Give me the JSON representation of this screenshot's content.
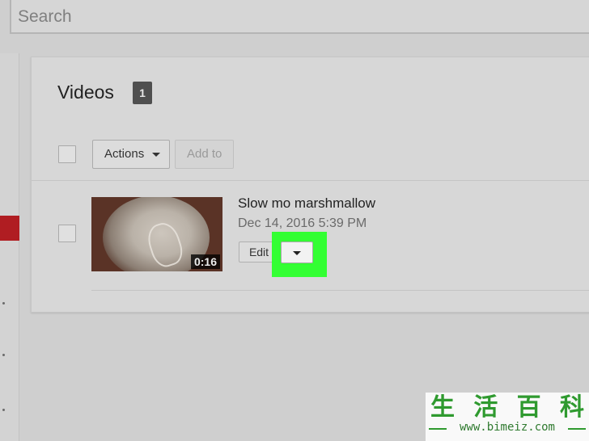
{
  "search": {
    "placeholder": "Search"
  },
  "card": {
    "title": "Videos",
    "count": "1"
  },
  "toolbar": {
    "actions_label": "Actions",
    "add_to_label": "Add to"
  },
  "video": {
    "title": "Slow mo marshmallow",
    "date": "Dec 14, 2016 5:39 PM",
    "duration": "0:16",
    "edit_label": "Edit"
  },
  "watermark": {
    "glyphs": [
      "生",
      "活",
      "百",
      "科"
    ],
    "url": "www.bimeiz.com"
  },
  "colors": {
    "highlight": "#33ff33",
    "sidebar_active": "#b01d22",
    "badge": "#4f4f4f"
  }
}
